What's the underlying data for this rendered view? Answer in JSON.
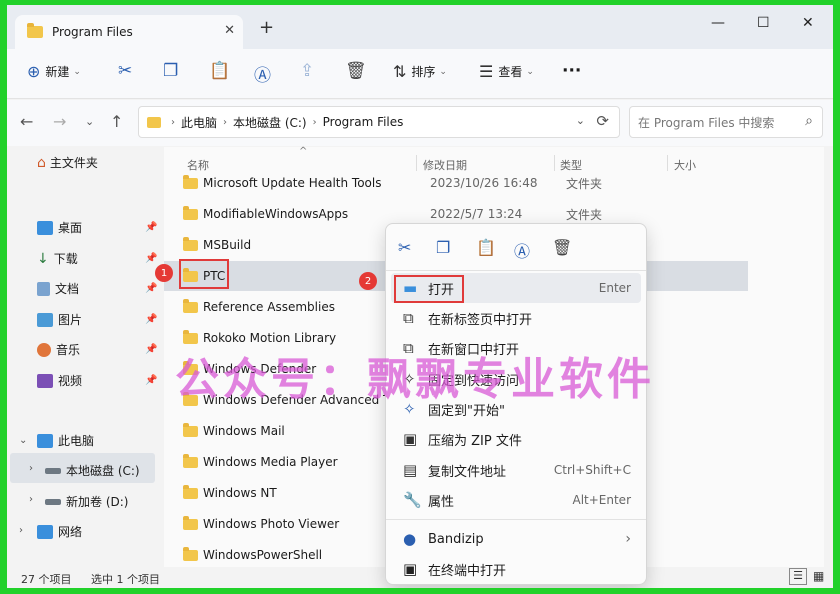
{
  "tab": {
    "title": "Program Files",
    "close": "✕",
    "new": "+"
  },
  "window_controls": {
    "minimize": "—",
    "maximize": "☐",
    "close": "✕"
  },
  "toolbar": {
    "new_label": "新建",
    "sort_label": "排序",
    "view_label": "查看",
    "more": "···"
  },
  "address": {
    "crumbs": [
      "此电脑",
      "本地磁盘 (C:)",
      "Program Files"
    ],
    "search_placeholder": "在 Program Files 中搜索"
  },
  "sidebar": {
    "home": "主文件夹",
    "quick": [
      "桌面",
      "下载",
      "文档",
      "图片",
      "音乐",
      "视频"
    ],
    "thispc": "此电脑",
    "drives": [
      "本地磁盘 (C:)",
      "新加卷 (D:)"
    ],
    "network": "网络"
  },
  "columns": {
    "name": "名称",
    "date": "修改日期",
    "type": "类型",
    "size": "大小"
  },
  "files": [
    {
      "name": "Microsoft Update Health Tools",
      "date": "2023/10/26 16:48",
      "type": "文件夹"
    },
    {
      "name": "ModifiableWindowsApps",
      "date": "2022/5/7 13:24",
      "type": "文件夹"
    },
    {
      "name": "MSBuild",
      "date": "",
      "type": ""
    },
    {
      "name": "PTC",
      "date": "",
      "type": ""
    },
    {
      "name": "Reference Assemblies",
      "date": "",
      "type": ""
    },
    {
      "name": "Rokoko Motion Library",
      "date": "",
      "type": ""
    },
    {
      "name": "Windows Defender",
      "date": "",
      "type": ""
    },
    {
      "name": "Windows Defender Advanced Th",
      "date": "",
      "type": ""
    },
    {
      "name": "Windows Mail",
      "date": "",
      "type": ""
    },
    {
      "name": "Windows Media Player",
      "date": "",
      "type": ""
    },
    {
      "name": "Windows NT",
      "date": "",
      "type": ""
    },
    {
      "name": "Windows Photo Viewer",
      "date": "",
      "type": ""
    },
    {
      "name": "WindowsPowerShell",
      "date": "",
      "type": ""
    }
  ],
  "badges": [
    "1",
    "2"
  ],
  "context_menu": {
    "items": [
      {
        "label": "打开",
        "shortcut": "Enter"
      },
      {
        "label": "在新标签页中打开",
        "shortcut": ""
      },
      {
        "label": "在新窗口中打开",
        "shortcut": ""
      },
      {
        "label": "固定到快速访问",
        "shortcut": ""
      },
      {
        "label": "固定到\"开始\"",
        "shortcut": ""
      },
      {
        "label": "压缩为 ZIP 文件",
        "shortcut": ""
      },
      {
        "label": "复制文件地址",
        "shortcut": "Ctrl+Shift+C"
      },
      {
        "label": "属性",
        "shortcut": "Alt+Enter"
      },
      {
        "label": "Bandizip",
        "shortcut": ""
      },
      {
        "label": "在终端中打开",
        "shortcut": ""
      }
    ]
  },
  "status": {
    "count": "27 个项目",
    "selected": "选中 1 个项目"
  },
  "watermark": "公众号：飘飘专业软件"
}
